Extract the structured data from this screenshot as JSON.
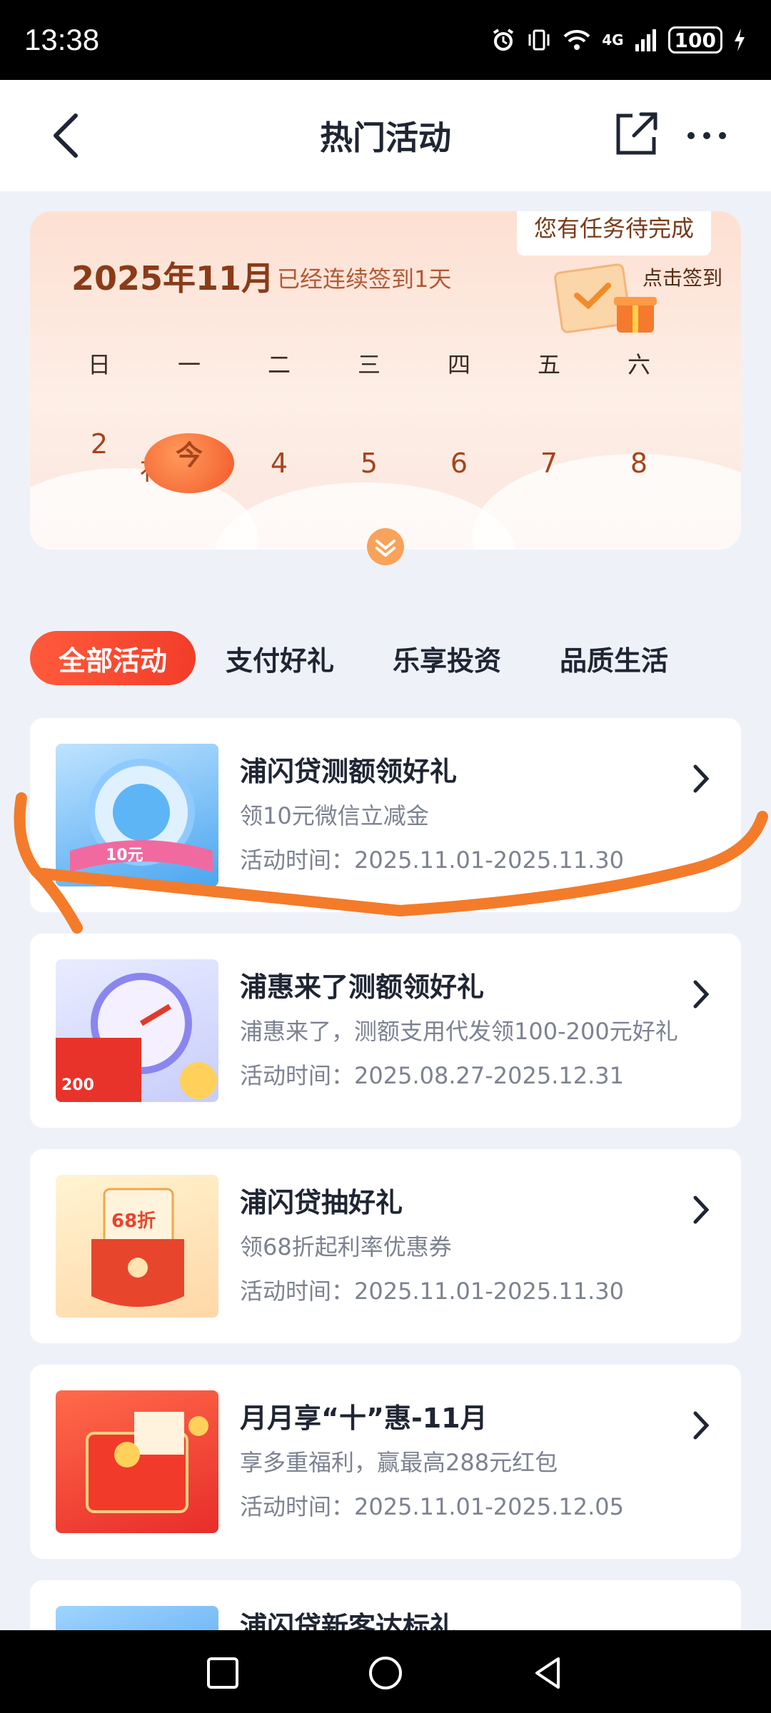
{
  "status_bar": {
    "time": "13:38",
    "network": "4G",
    "battery": "100"
  },
  "header": {
    "title": "热门活动",
    "back_icon": "chevron-left-icon",
    "share_icon": "share-icon",
    "more_icon": "more-icon"
  },
  "calendar": {
    "month": "2025年11月",
    "streak_text": "已经连续签到1天",
    "task_tip": "您有任务待完成",
    "signin_label": "点击签到",
    "weekdays": [
      "日",
      "一",
      "二",
      "三",
      "四",
      "五",
      "六"
    ],
    "dates": [
      "2",
      "今",
      "4",
      "5",
      "6",
      "7",
      "8"
    ],
    "makeup_badge": "补",
    "accent_color": "#f2572a"
  },
  "tabs": [
    {
      "label": "全部活动",
      "active": true
    },
    {
      "label": "支付好礼",
      "active": false
    },
    {
      "label": "乐享投资",
      "active": false
    },
    {
      "label": "品质生活",
      "active": false
    }
  ],
  "activities": [
    {
      "title": "浦闪贷测额领好礼",
      "desc": "领10元微信立减金",
      "time": "活动时间：2025.11.01-2025.11.30",
      "thumb_text": "10元"
    },
    {
      "title": "浦惠来了测额领好礼",
      "desc": "浦惠来了，测额支用代发领100-200元好礼",
      "time": "活动时间：2025.08.27-2025.12.31",
      "thumb_text": "200"
    },
    {
      "title": "浦闪贷抽好礼",
      "desc": "领68折起利率优惠券",
      "time": "活动时间：2025.11.01-2025.11.30",
      "thumb_text": "68折"
    },
    {
      "title": "月月享“十”惠-11月",
      "desc": "享多重福利，赢最高288元红包",
      "time": "活动时间：2025.11.01-2025.12.05",
      "thumb_text": ""
    },
    {
      "title": "浦闪贷新客达标礼",
      "desc": "",
      "time": "",
      "thumb_text": ""
    }
  ],
  "nav_bar": {
    "icons": [
      "square-recents-icon",
      "circle-home-icon",
      "triangle-back-icon"
    ]
  }
}
